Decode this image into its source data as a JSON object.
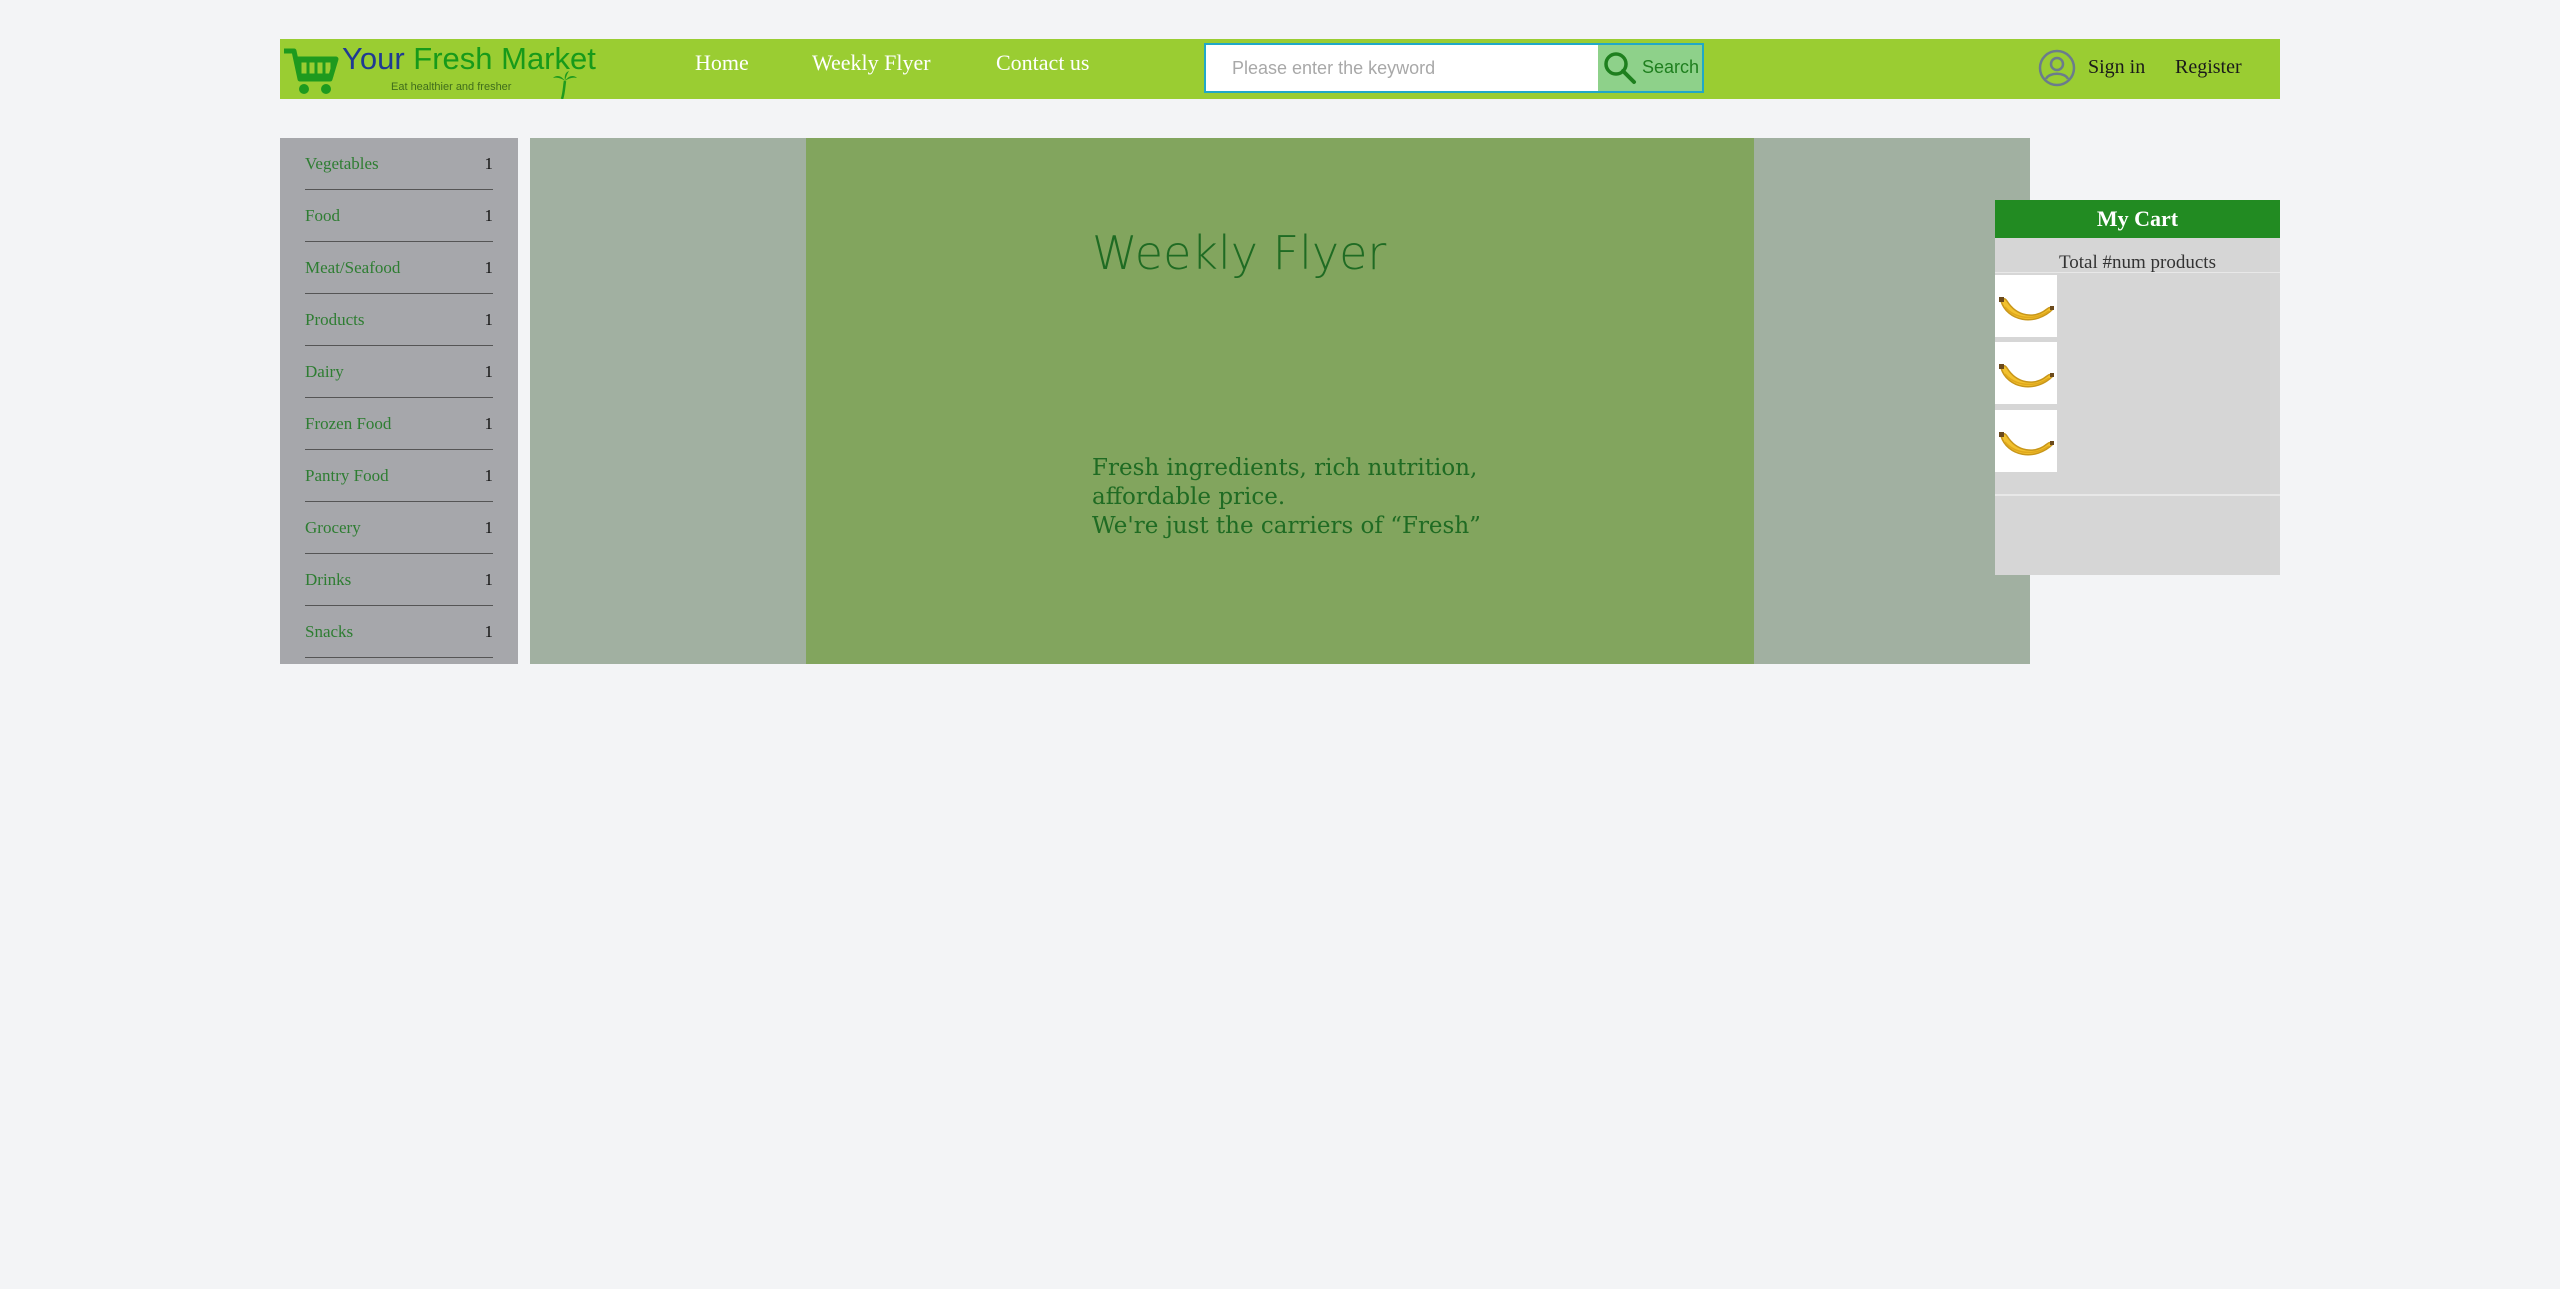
{
  "logo": {
    "title_part1": "Your",
    "title_part2": "Fresh Market",
    "tagline": "Eat healthier and fresher"
  },
  "nav": {
    "items": [
      {
        "label": "Home"
      },
      {
        "label": "Weekly Flyer"
      },
      {
        "label": "Contact us"
      }
    ]
  },
  "search": {
    "placeholder": "Please enter the keyword",
    "value": "",
    "button_label": "Search"
  },
  "account": {
    "sign_in": "Sign in",
    "register": "Register"
  },
  "sidebar": {
    "categories": [
      {
        "label": "Vegetables",
        "count": "1"
      },
      {
        "label": "Food",
        "count": "1"
      },
      {
        "label": "Meat/Seafood",
        "count": "1"
      },
      {
        "label": "Products",
        "count": "1"
      },
      {
        "label": "Dairy",
        "count": "1"
      },
      {
        "label": "Frozen Food",
        "count": "1"
      },
      {
        "label": "Pantry Food",
        "count": "1"
      },
      {
        "label": "Grocery",
        "count": "1"
      },
      {
        "label": "Drinks",
        "count": "1"
      },
      {
        "label": "Snacks",
        "count": "1"
      }
    ]
  },
  "banner": {
    "title": "Weekly Flyer",
    "lines": [
      "Fresh ingredients, rich nutrition,",
      "affordable price.",
      "We're just the carriers of “Fresh”"
    ]
  },
  "cart": {
    "title": "My Cart",
    "total_text": "Total #num products",
    "items": [
      {
        "icon": "banana-icon"
      },
      {
        "icon": "banana-icon"
      },
      {
        "icon": "banana-icon"
      }
    ]
  },
  "colors": {
    "header_bg": "#9acd32",
    "accent_green": "#228b22",
    "sidebar_bg": "#a6a7ab",
    "banner_bg": "#a1b0a1",
    "banner_panel": "#82a55e",
    "search_border": "#20a8c8"
  }
}
